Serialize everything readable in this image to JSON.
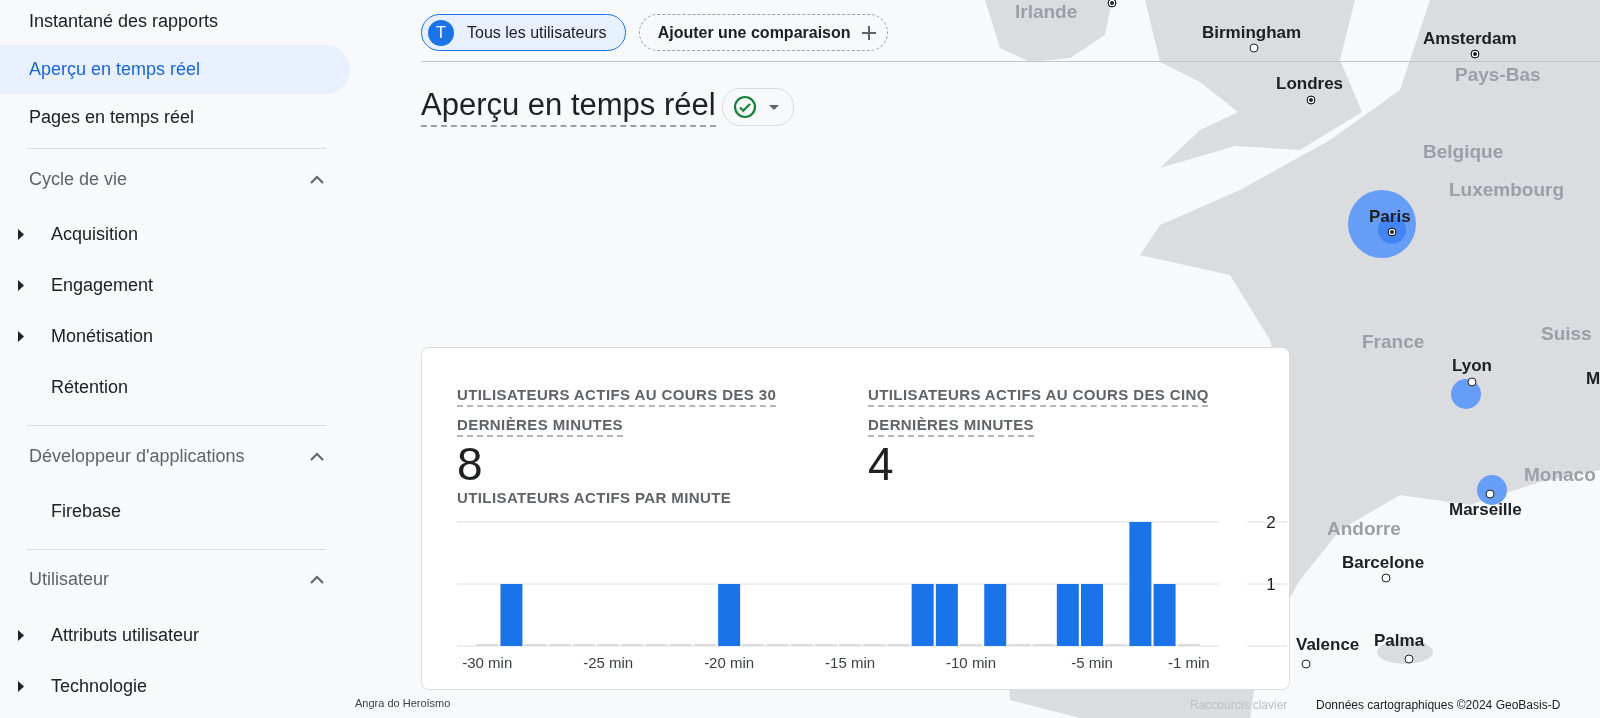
{
  "sidebar": {
    "top_items": [
      {
        "label": "Instantané des rapports",
        "selected": false
      },
      {
        "label": "Aperçu en temps réel",
        "selected": true
      },
      {
        "label": "Pages en temps réel",
        "selected": false
      }
    ],
    "sections": [
      {
        "title": "Cycle de vie",
        "expanded": true,
        "items": [
          {
            "label": "Acquisition",
            "expandable": true
          },
          {
            "label": "Engagement",
            "expandable": true
          },
          {
            "label": "Monétisation",
            "expandable": true
          },
          {
            "label": "Rétention",
            "expandable": false
          }
        ]
      },
      {
        "title": "Développeur d'applications",
        "expanded": true,
        "items": [
          {
            "label": "Firebase",
            "expandable": false
          }
        ]
      },
      {
        "title": "Utilisateur",
        "expanded": true,
        "items": [
          {
            "label": "Attributs utilisateur",
            "expandable": true
          },
          {
            "label": "Technologie",
            "expandable": true
          }
        ]
      }
    ]
  },
  "comparison_bar": {
    "segment": {
      "initial": "T",
      "label": "Tous les utilisateurs"
    },
    "add_button": "Ajouter une comparaison"
  },
  "page_title": "Aperçu en temps réel",
  "map": {
    "places": [
      {
        "name": "Irlande",
        "kind": "country"
      },
      {
        "name": "Birmingham",
        "kind": "city"
      },
      {
        "name": "Amsterdam",
        "kind": "capital"
      },
      {
        "name": "Pays-Bas",
        "kind": "country"
      },
      {
        "name": "Londres",
        "kind": "capital"
      },
      {
        "name": "Belgique",
        "kind": "country"
      },
      {
        "name": "Luxembourg",
        "kind": "country"
      },
      {
        "name": "Paris",
        "kind": "capital"
      },
      {
        "name": "France",
        "kind": "country"
      },
      {
        "name": "Suiss",
        "kind": "country"
      },
      {
        "name": "Lyon",
        "kind": "city"
      },
      {
        "name": "M",
        "kind": "city"
      },
      {
        "name": "Monaco",
        "kind": "country"
      },
      {
        "name": "Marseille",
        "kind": "city"
      },
      {
        "name": "Andorre",
        "kind": "country"
      },
      {
        "name": "Barcelone",
        "kind": "city"
      },
      {
        "name": "Palma",
        "kind": "city"
      },
      {
        "name": "Valence",
        "kind": "city"
      },
      {
        "name": "Angra do Heroísmo",
        "kind": "small"
      }
    ],
    "attribution": {
      "shortcuts": "Raccourcis clavier",
      "data": "Données cartographiques ©2024 GeoBasis-D"
    }
  },
  "card": {
    "metrics": [
      {
        "label": "UTILISATEURS ACTIFS AU COURS DES 30 DERNIÈRES MINUTES",
        "value": "8"
      },
      {
        "label": "UTILISATEURS ACTIFS AU COURS DES CINQ DERNIÈRES MINUTES",
        "value": "4"
      }
    ],
    "chart_data": {
      "type": "bar",
      "title": "UTILISATEURS ACTIFS PAR MINUTE",
      "x": [
        -30,
        -29,
        -28,
        -27,
        -26,
        -25,
        -24,
        -23,
        -22,
        -21,
        -20,
        -19,
        -18,
        -17,
        -16,
        -15,
        -14,
        -13,
        -12,
        -11,
        -10,
        -9,
        -8,
        -7,
        -6,
        -5,
        -4,
        -3,
        -2,
        -1
      ],
      "values": [
        0,
        1,
        0,
        0,
        0,
        0,
        0,
        0,
        0,
        0,
        1,
        0,
        0,
        0,
        0,
        0,
        0,
        0,
        1,
        1,
        0,
        1,
        0,
        0,
        1,
        1,
        0,
        2,
        1,
        0
      ],
      "xlim": [
        -31.25,
        0.25
      ],
      "ylim": [
        0,
        2
      ],
      "yticks": [
        1,
        2
      ],
      "xticks": [
        {
          "value": -30,
          "label": "-30 min"
        },
        {
          "value": -25,
          "label": "-25 min"
        },
        {
          "value": -20,
          "label": "-20 min"
        },
        {
          "value": -15,
          "label": "-15 min"
        },
        {
          "value": -10,
          "label": "-10 min"
        },
        {
          "value": -5,
          "label": "-5 min"
        },
        {
          "value": -1,
          "label": "-1 min"
        }
      ]
    }
  }
}
